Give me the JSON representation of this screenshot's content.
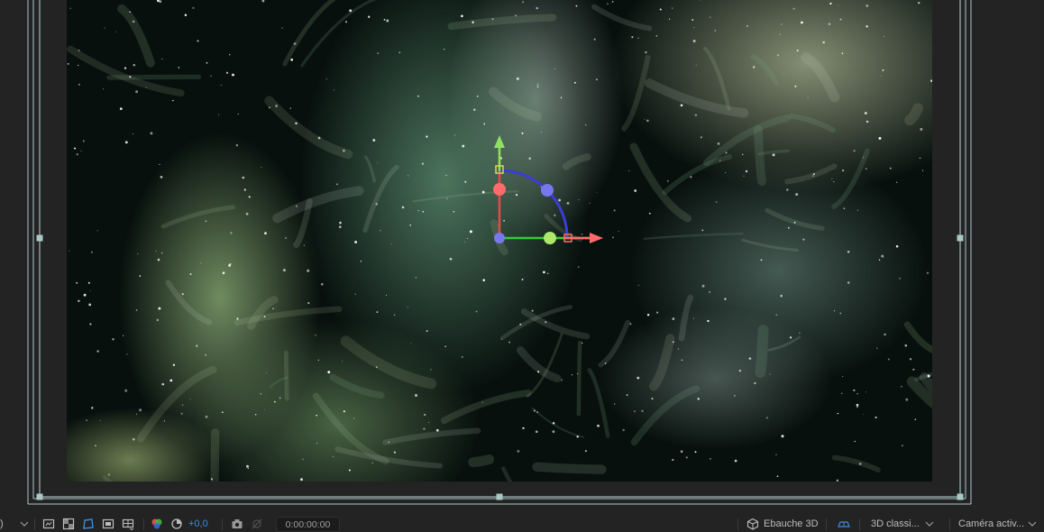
{
  "viewer": {
    "composition_frame": "space-nebula-composition"
  },
  "gizmo": {
    "x_axis_color": "#ff6b6b",
    "y_axis_color": "#8ee060",
    "z_axis_color": "#3c3cd8"
  },
  "toolbar": {
    "left_paren": ")",
    "exposure_value": "+0,0",
    "timecode": "0:00:00:00",
    "renderer_label": "Ebauche 3D",
    "renderer_mode": "3D classi...",
    "camera_view": "Caméra activ...",
    "accent_color": "#3b8bdc"
  }
}
